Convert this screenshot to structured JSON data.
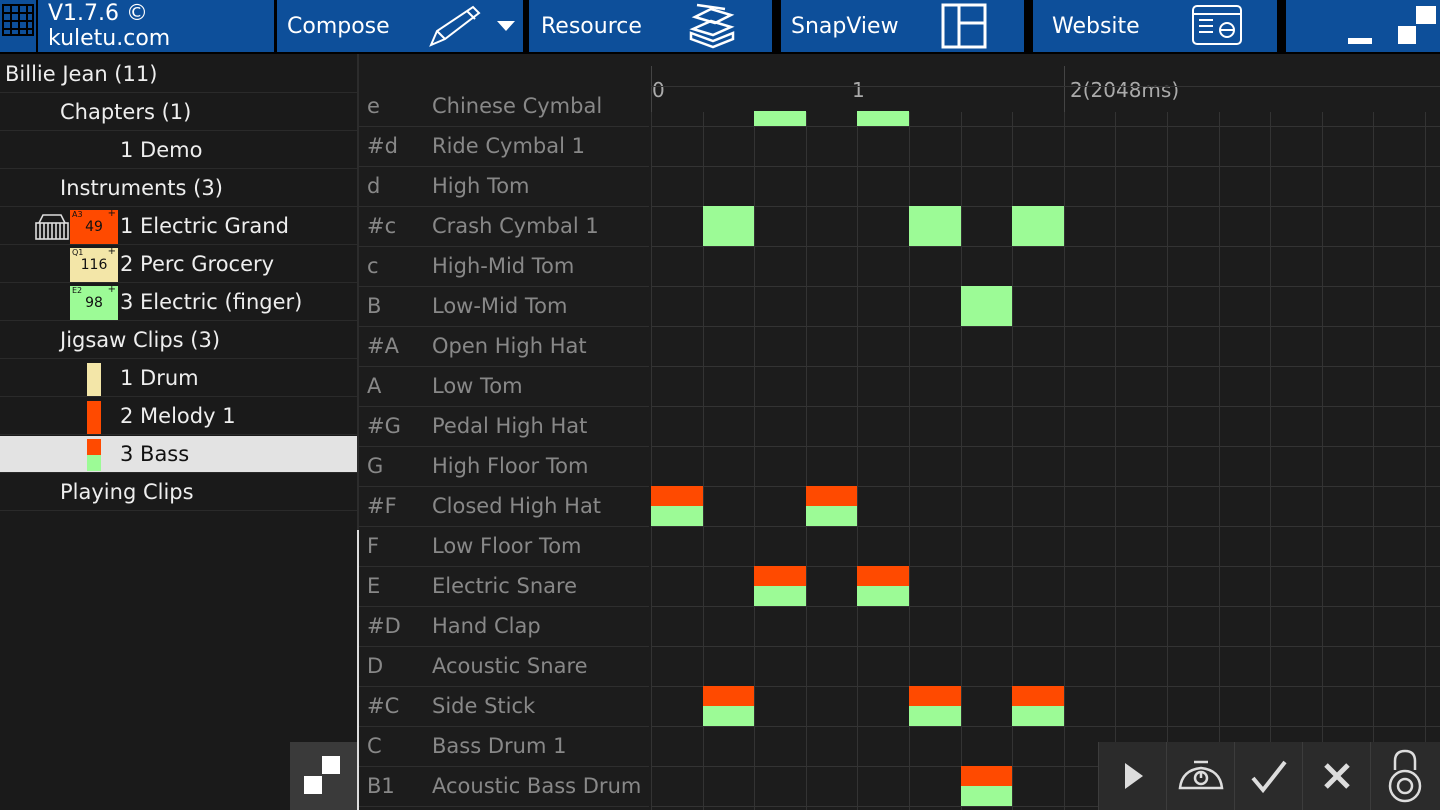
{
  "topbar": {
    "version": "V1.7.6 © kuletu.com",
    "compose": "Compose",
    "resource": "Resource",
    "snapview": "SnapView",
    "website": "Website"
  },
  "tree": {
    "song": "Billie Jean (11)",
    "chapters": "Chapters (1)",
    "chapter_items": [
      "1 Demo"
    ],
    "instruments": "Instruments (3)",
    "instrument_items": [
      {
        "label": "1 Electric Grand",
        "program": "49",
        "sup": "A3",
        "color": "#ff4a00",
        "textcolor": "#111"
      },
      {
        "label": "2 Perc Grocery",
        "program": "116",
        "sup": "Q1",
        "color": "#f3e6a8",
        "textcolor": "#111"
      },
      {
        "label": "3 Electric (finger)",
        "program": "98",
        "sup": "E2",
        "color": "#9cfb96",
        "textcolor": "#111"
      }
    ],
    "jigsaw": "Jigsaw Clips (3)",
    "clip_items": [
      {
        "label": "1 Drum",
        "colors": [
          "#f3e6a8"
        ]
      },
      {
        "label": "2 Melody 1",
        "colors": [
          "#ff4a00"
        ]
      },
      {
        "label": "3 Bass",
        "colors": [
          "#ff4a00",
          "#9cfb96"
        ]
      }
    ],
    "playing": "Playing Clips"
  },
  "ruler": {
    "labels": [
      "0",
      "1",
      "2(2048ms)"
    ]
  },
  "rows": [
    {
      "note": "e",
      "instrument": "Chinese Cymbal"
    },
    {
      "note": "#d",
      "instrument": "Ride Cymbal 1"
    },
    {
      "note": "d",
      "instrument": "High Tom"
    },
    {
      "note": "#c",
      "instrument": "Crash Cymbal 1"
    },
    {
      "note": "c",
      "instrument": "High-Mid Tom"
    },
    {
      "note": "B",
      "instrument": "Low-Mid Tom"
    },
    {
      "note": "#A",
      "instrument": "Open High Hat"
    },
    {
      "note": "A",
      "instrument": "Low Tom"
    },
    {
      "note": "#G",
      "instrument": "Pedal High Hat"
    },
    {
      "note": "G",
      "instrument": "High Floor Tom"
    },
    {
      "note": "#F",
      "instrument": "Closed High Hat"
    },
    {
      "note": "F",
      "instrument": "Low Floor Tom"
    },
    {
      "note": "E",
      "instrument": "Electric Snare"
    },
    {
      "note": "#D",
      "instrument": "Hand Clap"
    },
    {
      "note": "D",
      "instrument": "Acoustic Snare"
    },
    {
      "note": "#C",
      "instrument": "Side Stick"
    },
    {
      "note": "C",
      "instrument": "Bass Drum 1"
    },
    {
      "note": "B1",
      "instrument": "Acoustic Bass Drum"
    }
  ],
  "notes": [
    {
      "row": 0,
      "col": 2,
      "type": "green"
    },
    {
      "row": 0,
      "col": 4,
      "type": "green"
    },
    {
      "row": 3,
      "col": 1,
      "type": "green"
    },
    {
      "row": 3,
      "col": 5,
      "type": "green"
    },
    {
      "row": 3,
      "col": 7,
      "type": "green"
    },
    {
      "row": 5,
      "col": 6,
      "type": "green"
    },
    {
      "row": 10,
      "col": 0,
      "type": "split"
    },
    {
      "row": 10,
      "col": 3,
      "type": "split"
    },
    {
      "row": 12,
      "col": 2,
      "type": "split"
    },
    {
      "row": 12,
      "col": 4,
      "type": "split"
    },
    {
      "row": 15,
      "col": 1,
      "type": "split"
    },
    {
      "row": 15,
      "col": 5,
      "type": "split"
    },
    {
      "row": 15,
      "col": 7,
      "type": "split"
    },
    {
      "row": 17,
      "col": 6,
      "type": "split"
    }
  ],
  "colors": {
    "green": "#9cfb96",
    "orange": "#ff4a00",
    "cream": "#f3e6a8",
    "blue": "#0d4f9a"
  }
}
